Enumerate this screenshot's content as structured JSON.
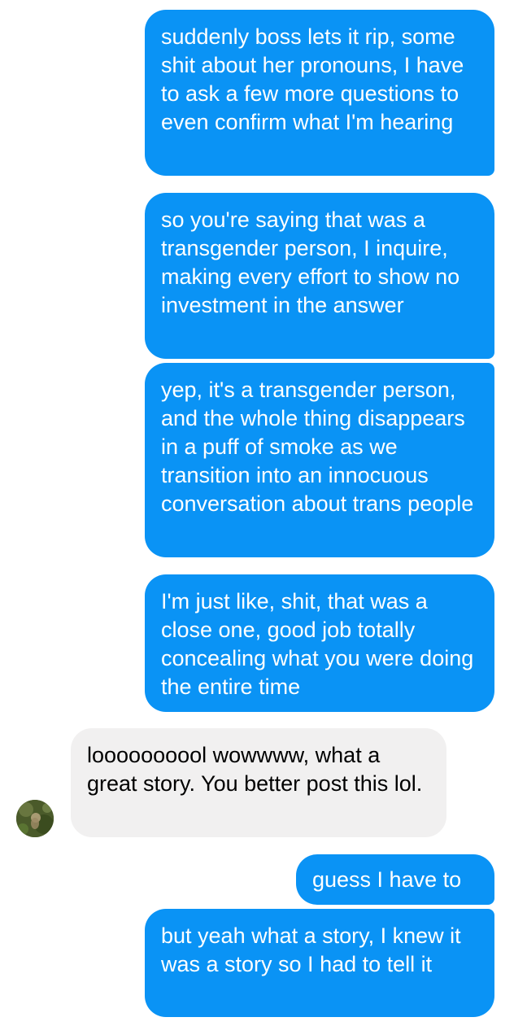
{
  "messages": [
    {
      "sender": "me",
      "text": "suddenly boss lets it rip, some shit about her pronouns, I have to ask a few more questions to even confirm what I'm hearing"
    },
    {
      "sender": "me",
      "text": "so you're saying that was a transgender person, I inquire, making every effort to show no investment in the answer"
    },
    {
      "sender": "me",
      "text": "yep, it's a transgender person, and the whole thing disappears in a puff of smoke as we transition into an innocuous conversation about trans people"
    },
    {
      "sender": "me",
      "text": "I'm just like, shit, that was a close one, good job totally concealing what you were doing the entire time"
    },
    {
      "sender": "them",
      "text": "loooooooool wowwww, what a great story. You better post this lol."
    },
    {
      "sender": "me",
      "text": "guess I have to"
    },
    {
      "sender": "me",
      "text": "but yeah what a story, I knew it was a story so I had to tell it"
    }
  ],
  "avatar": {
    "icon": "contact-avatar-photo"
  },
  "colors": {
    "outgoing_bubble": "#0a93f5",
    "incoming_bubble": "#f1f0f0",
    "outgoing_text": "#ffffff",
    "incoming_text": "#000000"
  }
}
